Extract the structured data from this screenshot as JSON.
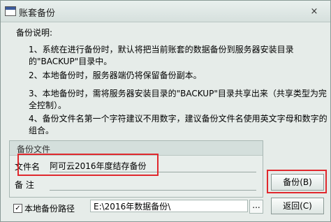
{
  "window": {
    "title": "账套备份",
    "close": "×"
  },
  "description": {
    "heading": "备份说明:",
    "item1": "1、系统在进行备份时，默认将把当前账套的数据备份到服务器安装目录的\"BACKUP\"目录中。",
    "item2": "2、本地备份时，服务器端仍将保留备份副本。",
    "item3": "3、本地备份时，需将服务器安装目录的\"BACKUP\"目录共享出来（共享类型为完全控制）。",
    "item4": "4、备份文件名第一个字符建议不用数字，建议备份文件名使用英文字母和数字的组合。"
  },
  "backup_file": {
    "group_title": "备份文件",
    "filename_label": "文件名",
    "filename_value": "阿可云2016年度结存备份",
    "remark_label": "备  注",
    "remark_value": ""
  },
  "buttons": {
    "backup": "备份(B)",
    "return": "返回(C)"
  },
  "local_path": {
    "checked": true,
    "checkbox_mark": "✓",
    "label": "本地备份路径",
    "value": "E:\\2016年数据备份\\",
    "browse": "..."
  },
  "colors": {
    "highlight": "#e0282d",
    "title_bar": "#d6e0dd"
  }
}
